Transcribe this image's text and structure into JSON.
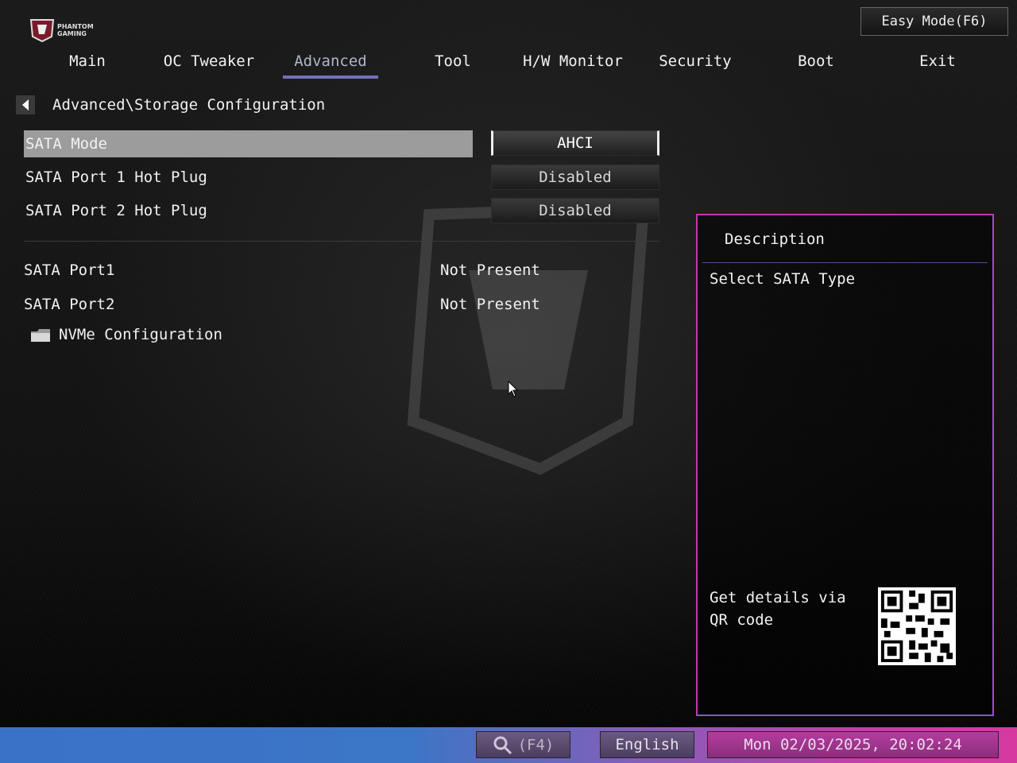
{
  "header": {
    "logo_text_line1": "PHANTOM",
    "logo_text_line2": "GAMING",
    "easy_mode_label": "Easy Mode(F6)"
  },
  "tabs": [
    {
      "label": "Main"
    },
    {
      "label": "OC Tweaker"
    },
    {
      "label": "Advanced",
      "active": true
    },
    {
      "label": "Tool"
    },
    {
      "label": "H/W Monitor"
    },
    {
      "label": "Security"
    },
    {
      "label": "Boot"
    },
    {
      "label": "Exit"
    }
  ],
  "breadcrumb": "Advanced\\Storage Configuration",
  "settings": [
    {
      "label": "SATA Mode",
      "value": "AHCI",
      "selected": true
    },
    {
      "label": "SATA Port 1 Hot Plug",
      "value": "Disabled"
    },
    {
      "label": "SATA Port 2 Hot Plug",
      "value": "Disabled"
    }
  ],
  "ports": [
    {
      "label": "SATA Port1",
      "value": "Not Present"
    },
    {
      "label": "SATA Port2",
      "value": "Not Present"
    }
  ],
  "submenu": {
    "label": "NVMe Configuration",
    "icon": "folder-icon"
  },
  "description": {
    "title": "Description",
    "text": "Select SATA Type",
    "qr_text": "Get details via QR code"
  },
  "footer": {
    "search_label": "(F4)",
    "language": "English",
    "datetime": "Mon 02/03/2025, 20:02:24"
  },
  "colors": {
    "tab_underline": "#7272b8",
    "selected_row": "#9c9c9c",
    "panel_border": "#c03aa8"
  }
}
